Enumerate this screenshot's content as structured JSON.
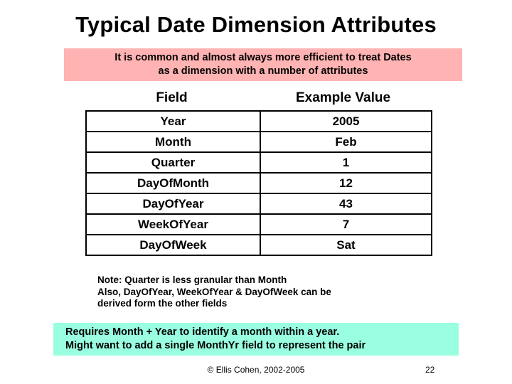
{
  "slide": {
    "title": "Typical Date Dimension Attributes",
    "page_number": "22",
    "copyright": "© Ellis Cohen, 2002-2005"
  },
  "intro_callout": {
    "background_color": "#ffb3b3",
    "line1": "It is common and almost always more efficient to treat Dates",
    "line2": "as a dimension with a number of attributes"
  },
  "attributes_table": {
    "columns": [
      "Field",
      "Example Value"
    ],
    "rows": [
      {
        "field": "Year",
        "value": "2005"
      },
      {
        "field": "Month",
        "value": "Feb"
      },
      {
        "field": "Quarter",
        "value": "1"
      },
      {
        "field": "DayOfMonth",
        "value": "12"
      },
      {
        "field": "DayOfYear",
        "value": "43"
      },
      {
        "field": "WeekOfYear",
        "value": "7"
      },
      {
        "field": "DayOfWeek",
        "value": "Sat"
      }
    ]
  },
  "note": {
    "line1": "Note: Quarter is less granular than Month",
    "line2": "Also, DayOfYear, WeekOfYear & DayOfWeek can be",
    "line3": "derived form the other fields"
  },
  "requires_callout": {
    "background_color": "#99ffe0",
    "line1": "Requires Month + Year to identify a month within a year.",
    "line2": "Might want to add a single MonthYr field to represent the pair"
  }
}
